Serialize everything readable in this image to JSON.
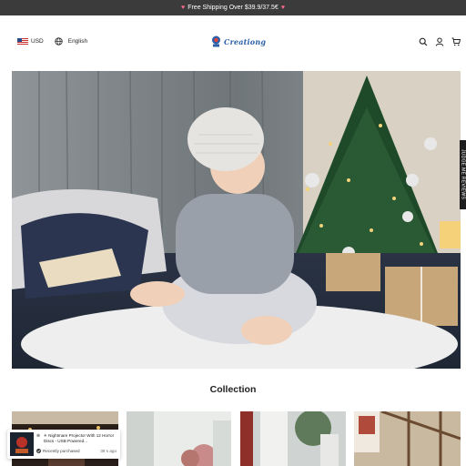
{
  "announcement": {
    "text": "Free Shipping Over $39.9/37.5€"
  },
  "header": {
    "currency": "USD",
    "language": "English",
    "logo_text": "Creationg",
    "icons": [
      "search-icon",
      "user-icon",
      "cart-icon"
    ]
  },
  "side_tab": {
    "label": "JUDGE.ME REVIEWS"
  },
  "collection": {
    "title": "Collection"
  },
  "popup": {
    "product": "✳ Nightmare Projector With 12 Horror Discs - USB Powered...",
    "status": "Recently purchased",
    "time": "39 s ago"
  },
  "colors": {
    "announcement_bg": "#3b3b3b",
    "logo": "#2b5fa8",
    "side_tab_bg": "#1e1e1e"
  }
}
